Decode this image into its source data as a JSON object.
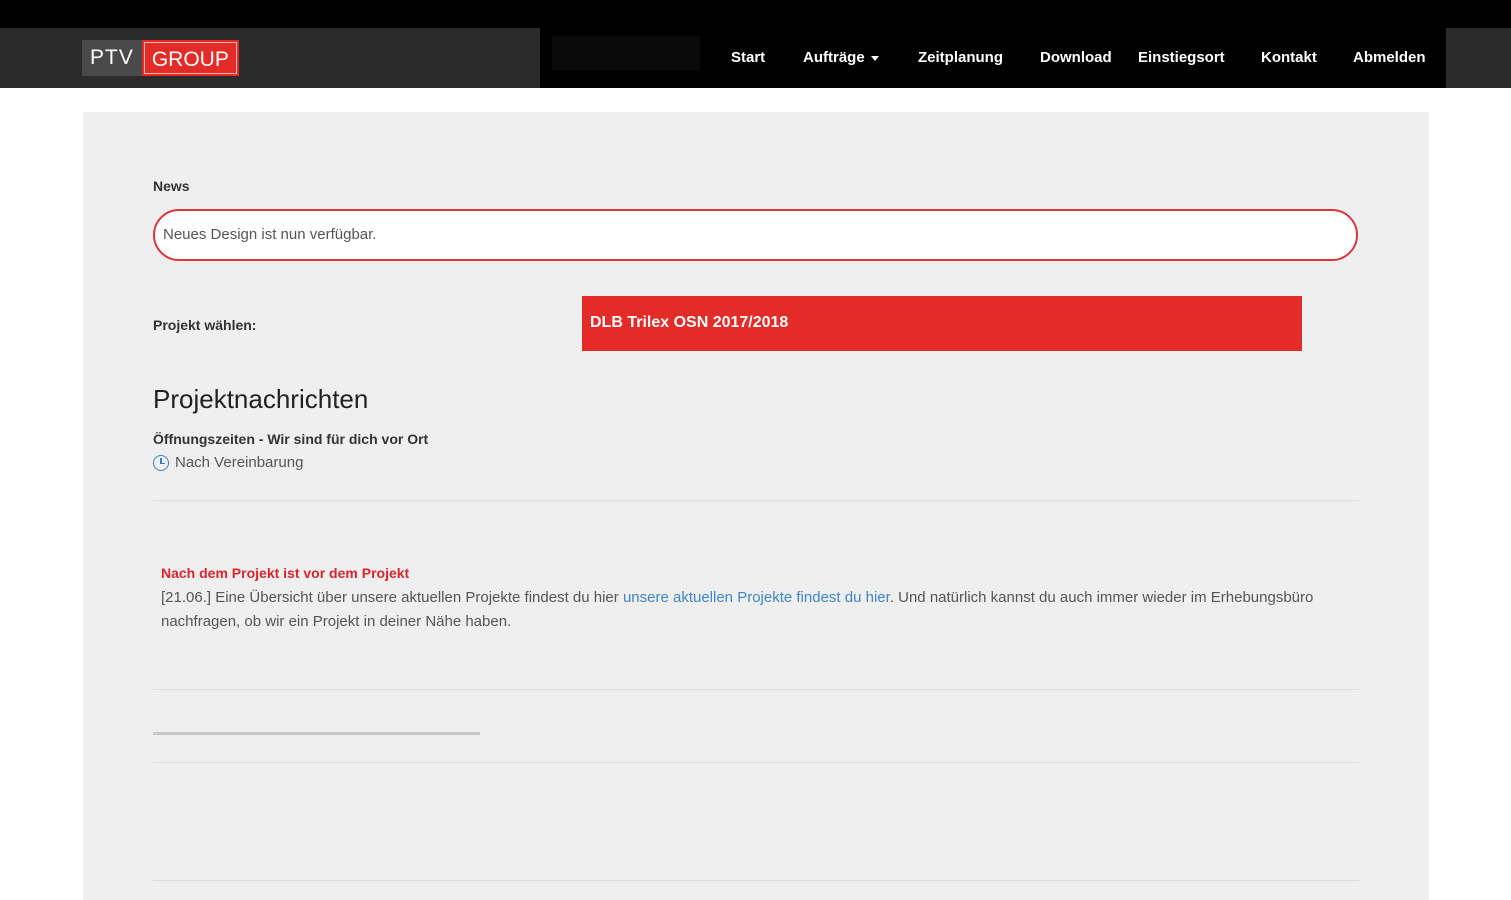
{
  "header": {
    "logo": {
      "part1": "PTV",
      "part2": "GROUP"
    },
    "nav": [
      {
        "label": "Start"
      },
      {
        "label": "Aufträge"
      },
      {
        "label": "Zeitplanung"
      },
      {
        "label": "Download"
      },
      {
        "label": "Einstiegsort"
      },
      {
        "label": "Kontakt"
      },
      {
        "label": "Abmelden"
      }
    ]
  },
  "main": {
    "news_label": "News",
    "news_text": "Neues Design ist nun verfügbar.",
    "project_label": "Projekt wählen:",
    "project_selected": "DLB Trilex OSN 2017/2018",
    "section_title": "Projektnachrichten",
    "hours_title": "Öffnungszeiten - Wir sind für dich vor Ort",
    "hours_value": "Nach Vereinbarung",
    "message": {
      "title": "Nach dem Projekt ist vor dem Projekt",
      "text_before": "[21.06.] Eine Übersicht über unsere aktuellen Projekte findest du hier",
      "link_text": "unsere aktuellen Projekte findest du hier",
      "text_after": ". Und natürlich kannst du auch immer wieder im Erhebungsbüro nachfragen, ob wir ein Projekt in deiner Nähe haben."
    }
  },
  "colors": {
    "accent": "#e32b27",
    "link": "#3f86c9",
    "navbar": "#000000",
    "panel": "#efefef"
  }
}
